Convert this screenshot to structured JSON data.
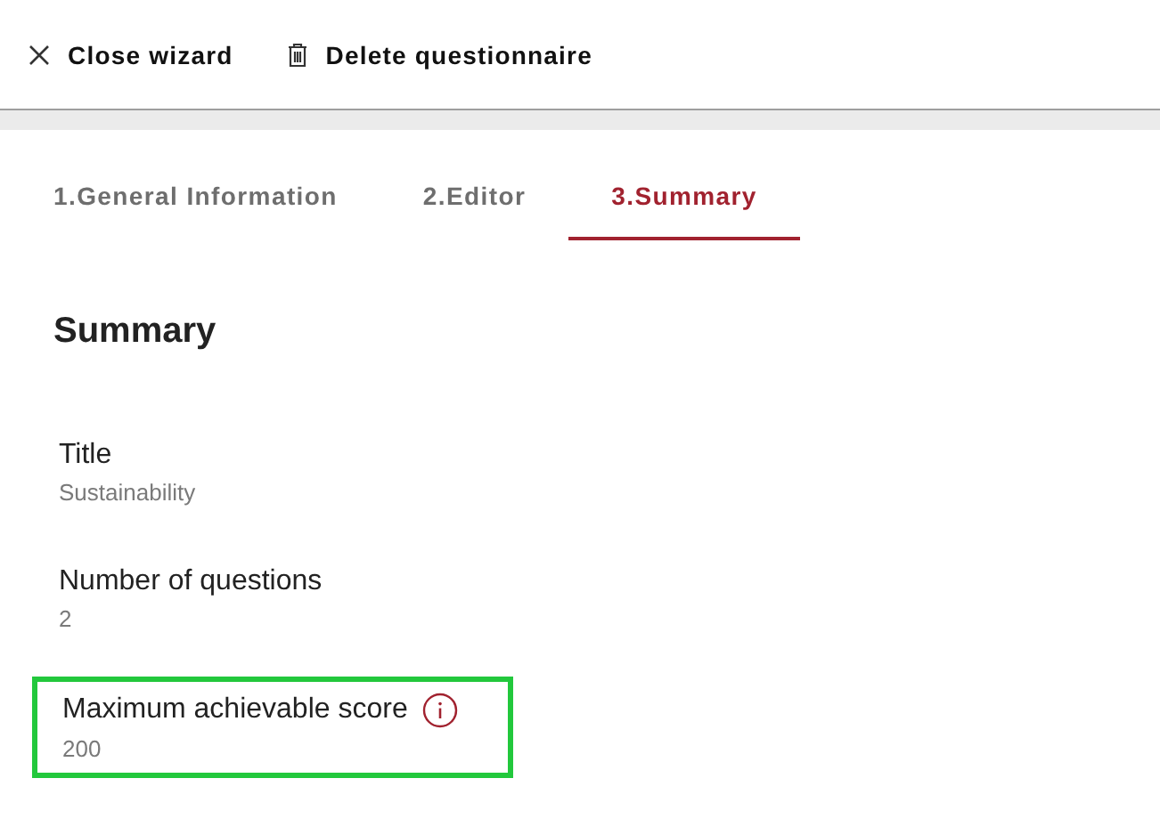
{
  "toolbar": [
    {
      "kind": "close",
      "label": "Close wizard"
    },
    {
      "kind": "delete",
      "label": "Delete questionnaire"
    }
  ],
  "tabs": [
    {
      "label": "1.General Information",
      "selected": false
    },
    {
      "label": "2.Editor",
      "selected": false
    },
    {
      "label": "3.Summary",
      "selected": true
    }
  ],
  "heading": "Summary",
  "fields": [
    {
      "label": "Title",
      "value": "Sustainability",
      "info": false,
      "highlighted": false
    },
    {
      "label": "Number of questions",
      "value": "2",
      "info": false,
      "highlighted": false
    },
    {
      "label": "Maximum achievable score",
      "value": "200",
      "info": true,
      "highlighted": true
    }
  ]
}
